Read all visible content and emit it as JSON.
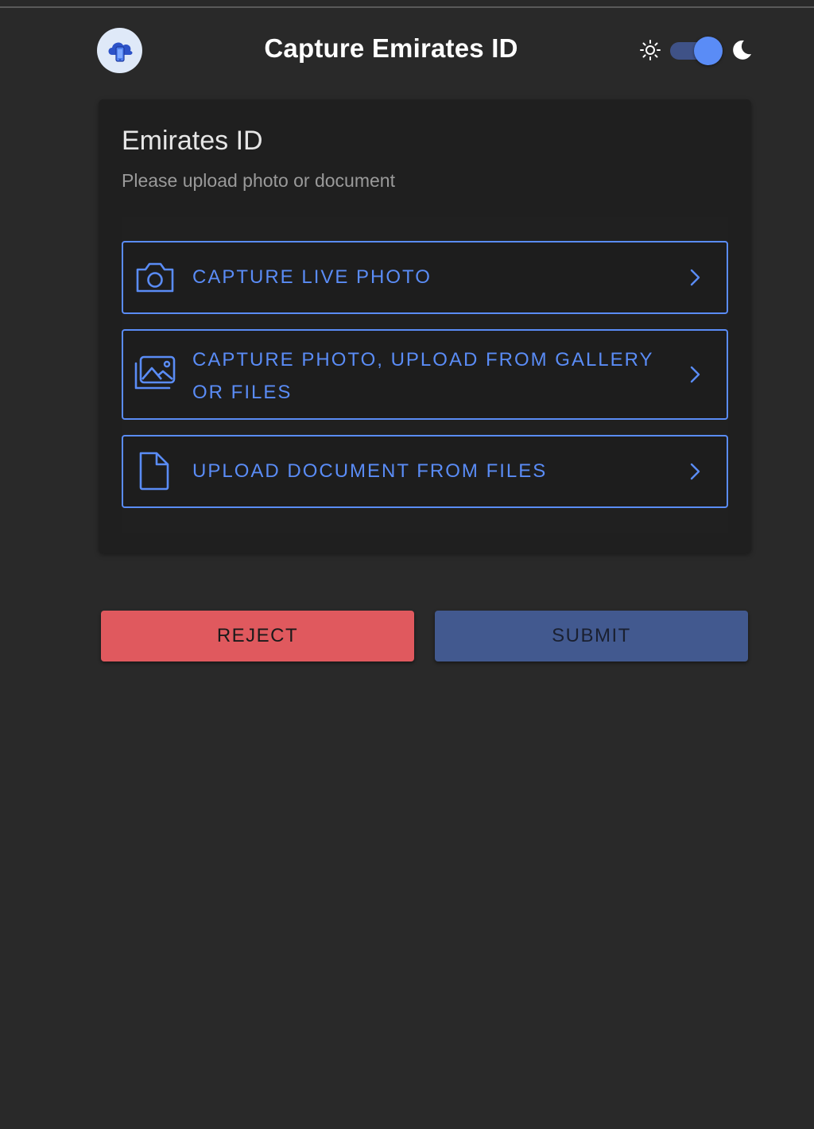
{
  "header": {
    "title": "Capture Emirates ID",
    "logo_icon": "cloud-phone-icon",
    "theme_toggle": {
      "light_icon": "sun-icon",
      "dark_icon": "moon-icon",
      "dark_mode_on": true
    }
  },
  "card": {
    "title": "Emirates ID",
    "subtitle": "Please upload photo or document",
    "options": [
      {
        "label": "CAPTURE LIVE PHOTO",
        "icon": "camera-icon"
      },
      {
        "label_line1": "CAPTURE PHOTO, UPLOAD FROM GALLERY",
        "label_line2": "OR FILES",
        "icon": "gallery-icon"
      },
      {
        "label": "UPLOAD DOCUMENT FROM FILES",
        "icon": "document-icon"
      }
    ]
  },
  "actions": {
    "reject_label": "REJECT",
    "submit_label": "SUBMIT"
  },
  "colors": {
    "accent": "#5a8cf6",
    "reject": "#e0595e",
    "submit": "#42598f",
    "background": "#292929",
    "card": "#1f1f1f"
  }
}
